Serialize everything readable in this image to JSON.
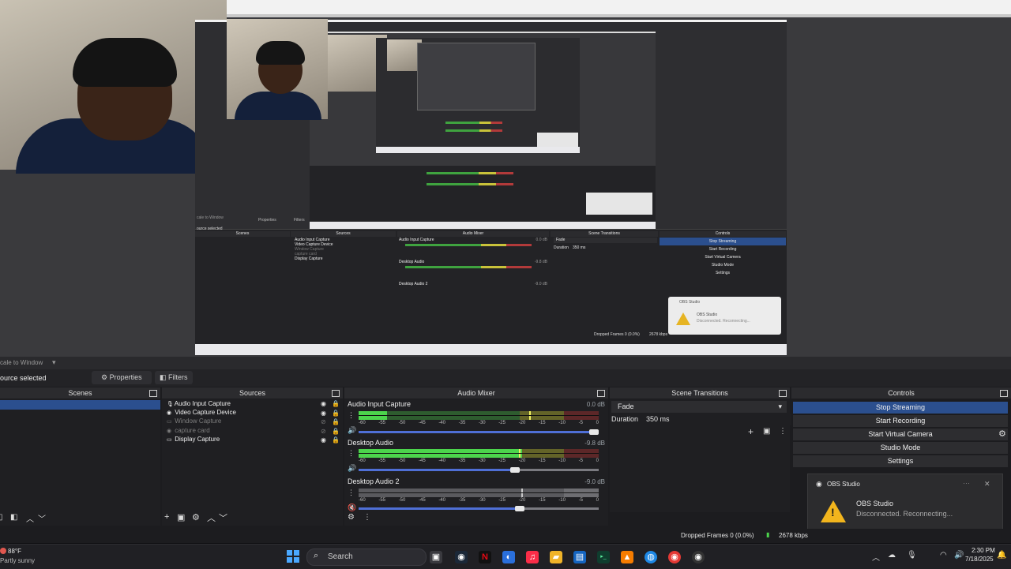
{
  "preview": {
    "scale_to_window": "cale to Window",
    "nested_scenes_label": "Scenes",
    "nested_sources_label": "Sources",
    "nested_mixer_label": "Audio Mixer",
    "nested_transitions_label": "Scene Transitions",
    "nested_controls_label": "Controls",
    "nested_sources": [
      "Audio Input Capture",
      "Video Capture Device",
      "Window Capture",
      "capture card",
      "Display Capture"
    ],
    "nested_mixer": [
      {
        "name": "Audio Input Capture",
        "db": "0.0 dB"
      },
      {
        "name": "Desktop Audio",
        "db": "-9.8 dB"
      },
      {
        "name": "Desktop Audio 2",
        "db": "-9.0 dB"
      }
    ],
    "nested_fade": "Fade",
    "nested_duration_label": "Duration",
    "nested_duration_value": "350 ms",
    "nested_controls": [
      "Stop Streaming",
      "Start Recording",
      "Start Virtual Camera",
      "Studio Mode",
      "Settings"
    ],
    "nested_toast_app": "OBS Studio",
    "nested_toast_title": "OBS Studio",
    "nested_toast_msg": "Disconnected. Reconnecting...",
    "nested_status": "Dropped Frames 0 (0.0%)",
    "nested_kbps": "2678 kbps",
    "nested_properties": "Properties",
    "nested_filters": "Filters",
    "nested_source_selected": "ource selected",
    "nested_scale": "cale to Window"
  },
  "toolbar": {
    "scale_label": "cale to Window",
    "source_selected": "ource selected",
    "properties_label": "Properties",
    "filters_label": "Filters"
  },
  "docks": {
    "scenes_title": "Scenes",
    "sources_title": "Sources",
    "mixer_title": "Audio Mixer",
    "transitions_title": "Scene Transitions",
    "controls_title": "Controls"
  },
  "sources": [
    {
      "label": "Audio Input Capture",
      "icon": "microphone-icon",
      "visible": true
    },
    {
      "label": "Video Capture Device",
      "icon": "camera-icon",
      "visible": true
    },
    {
      "label": "Window Capture",
      "icon": "window-icon",
      "visible": false
    },
    {
      "label": "capture card",
      "icon": "camera-icon",
      "visible": false
    },
    {
      "label": "Display Capture",
      "icon": "monitor-icon",
      "visible": true
    }
  ],
  "mixer": {
    "ticks": [
      "-60",
      "-55",
      "-50",
      "-45",
      "-40",
      "-35",
      "-30",
      "-25",
      "-20",
      "-15",
      "-10",
      "-5",
      "0"
    ],
    "channels": [
      {
        "name": "Audio Input Capture",
        "db": "0.0 dB",
        "level": 0.12,
        "fader": 1.0,
        "muted": false
      },
      {
        "name": "Desktop Audio",
        "db": "-9.8 dB",
        "level": 0.68,
        "fader": 0.65,
        "muted": false
      },
      {
        "name": "Desktop Audio 2",
        "db": "-9.0 dB",
        "level": 0.0,
        "fader": 0.67,
        "muted": true
      }
    ]
  },
  "transitions": {
    "selected": "Fade",
    "duration_label": "Duration",
    "duration_value": "350 ms"
  },
  "controls": {
    "stop_streaming": "Stop Streaming",
    "start_recording": "Start Recording",
    "start_virtual_camera": "Start Virtual Camera",
    "studio_mode": "Studio Mode",
    "settings": "Settings"
  },
  "toast": {
    "app": "OBS Studio",
    "title": "OBS Studio",
    "message": "Disconnected. Reconnecting...",
    "more": "···",
    "close": "✕"
  },
  "status": {
    "dropped_frames": "Dropped Frames 0 (0.0%)",
    "kbps": "2678 kbps"
  },
  "taskbar": {
    "weather_temp": "88°F",
    "weather_desc": "Partly sunny",
    "search_placeholder": "Search",
    "time": "2:30 PM",
    "date": "7/18/2025"
  },
  "colors": {
    "active_control": "#2b4f8e",
    "meter_green": "#3b8e3b",
    "meter_yellow": "#9a9a2e",
    "meter_red": "#8e2e2e",
    "fader_blue": "#4f6fd6",
    "warning": "#f2b51d"
  }
}
